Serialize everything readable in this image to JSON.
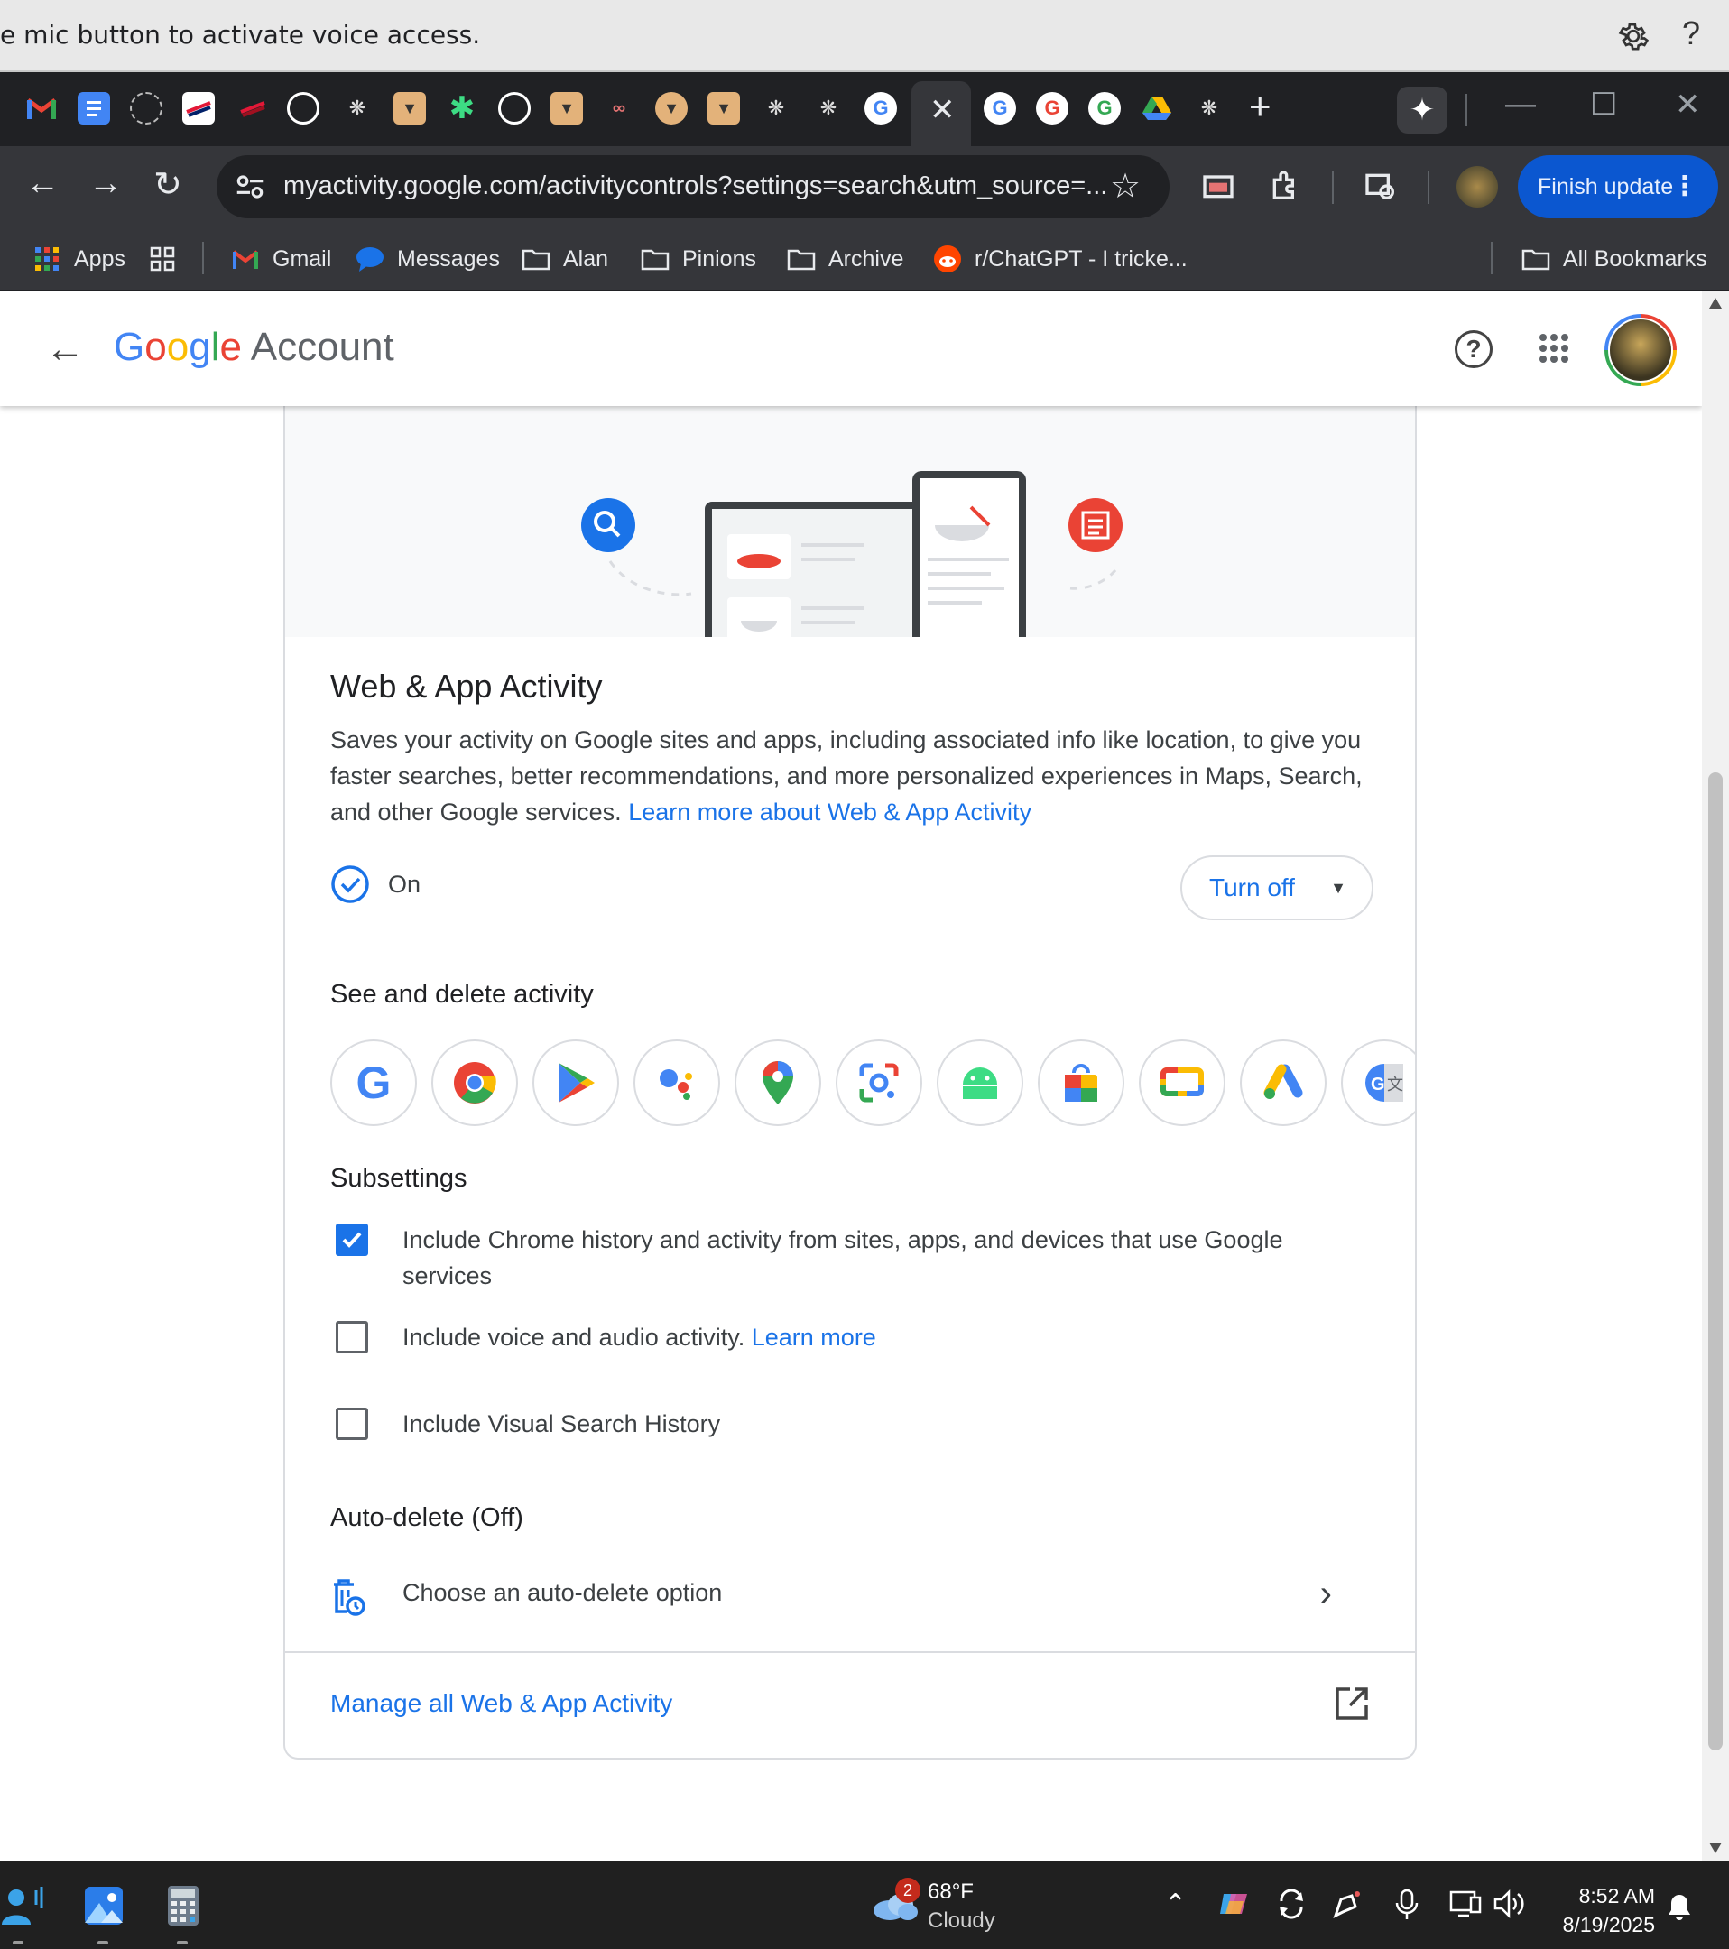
{
  "voice_bar": {
    "message": "e mic button to activate voice access.",
    "help": "?"
  },
  "tabs": {
    "close": "✕",
    "new_tab": "+",
    "gemini": "✦",
    "minimize": "—",
    "maximize": "☐",
    "close_window": "✕"
  },
  "toolbar": {
    "url": "myactivity.google.com/activitycontrols?settings=search&utm_source=...",
    "finish_update": "Finish update"
  },
  "bookmarks": {
    "apps": "Apps",
    "gmail": "Gmail",
    "messages": "Messages",
    "alan": "Alan",
    "pinions": "Pinions",
    "archive": "Archive",
    "reddit": "r/ChatGPT - I tricke...",
    "all": "All Bookmarks"
  },
  "header": {
    "logo_google": "Google",
    "logo_account": "Account"
  },
  "activity": {
    "title": "Web & App Activity",
    "description": "Saves your activity on Google sites and apps, including associated info like location, to give you faster searches, better recommendations, and more personalized experiences in Maps, Search, and other Google services.",
    "learn_more": "Learn more about Web & App Activity",
    "status": "On",
    "turn_off": "Turn off",
    "see_delete": "See and delete activity",
    "subsettings": "Subsettings",
    "sub_chrome": "Include Chrome history and activity from sites, apps, and devices that use Google services",
    "sub_voice": "Include voice and audio activity.",
    "sub_voice_link": "Learn more",
    "sub_visual": "Include Visual Search History",
    "autodelete_title": "Auto-delete (Off)",
    "autodelete_option": "Choose an auto-delete option",
    "manage": "Manage all Web & App Activity"
  },
  "taskbar": {
    "weather_badge": "2",
    "temperature": "68°F",
    "condition": "Cloudy",
    "time": "8:52 AM",
    "date": "8/19/2025"
  },
  "colors": {
    "accent": "#1a73e8",
    "finish_update_bg": "#0b57d0",
    "chrome_dark": "#202124"
  }
}
